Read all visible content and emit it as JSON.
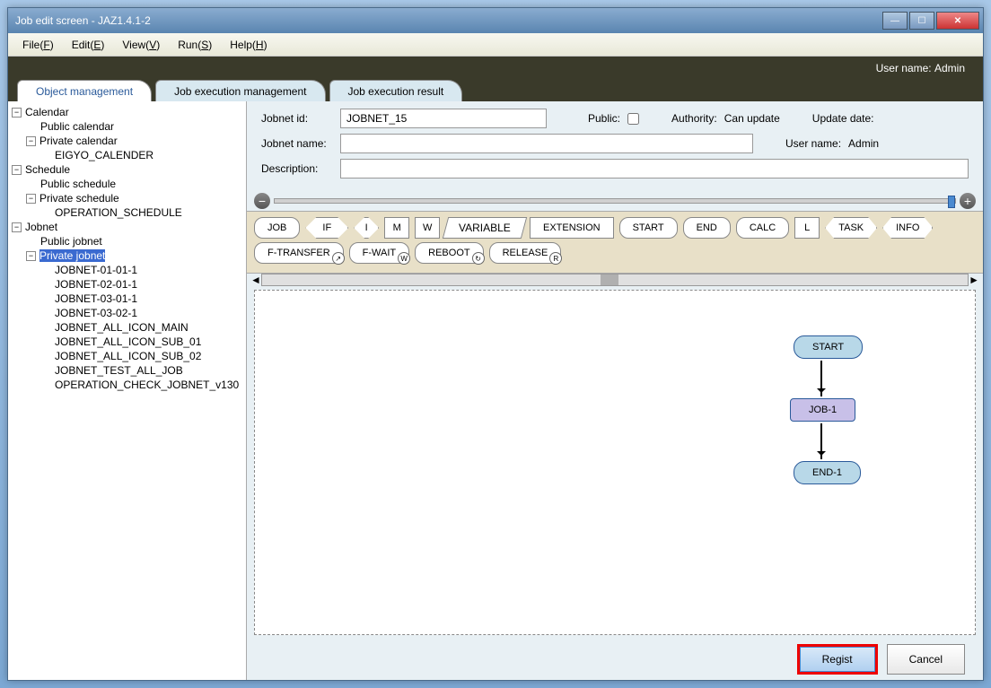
{
  "window": {
    "title": "Job edit screen - JAZ1.4.1-2"
  },
  "menu": {
    "file": "File(F)",
    "edit": "Edit(E)",
    "view": "View(V)",
    "run": "Run(S)",
    "help": "Help(H)"
  },
  "header": {
    "user_label": "User name:",
    "user_value": "Admin"
  },
  "tabs": {
    "t1": "Object management",
    "t2": "Job execution management",
    "t3": "Job execution result"
  },
  "tree": {
    "calendar": "Calendar",
    "public_calendar": "Public calendar",
    "private_calendar": "Private calendar",
    "eigyo": "EIGYO_CALENDER",
    "schedule": "Schedule",
    "public_schedule": "Public schedule",
    "private_schedule": "Private schedule",
    "op_schedule": "OPERATION_SCHEDULE",
    "jobnet": "Jobnet",
    "public_jobnet": "Public jobnet",
    "private_jobnet": "Private jobnet",
    "j1": "JOBNET-01-01-1",
    "j2": "JOBNET-02-01-1",
    "j3": "JOBNET-03-01-1",
    "j4": "JOBNET-03-02-1",
    "j5": "JOBNET_ALL_ICON_MAIN",
    "j6": "JOBNET_ALL_ICON_SUB_01",
    "j7": "JOBNET_ALL_ICON_SUB_02",
    "j8": "JOBNET_TEST_ALL_JOB",
    "j9": "OPERATION_CHECK_JOBNET_v130"
  },
  "form": {
    "jobnet_id_label": "Jobnet id:",
    "jobnet_id_value": "JOBNET_15",
    "public_label": "Public:",
    "authority_label": "Authority:",
    "authority_value": "Can update",
    "update_label": "Update date:",
    "jobnet_name_label": "Jobnet name:",
    "user_label": "User name:",
    "user_value": "Admin",
    "description_label": "Description:"
  },
  "tools": {
    "job": "JOB",
    "if": "IF",
    "variable": "VARIABLE",
    "extension": "EXTENSION",
    "start": "START",
    "end": "END",
    "calc": "CALC",
    "task": "TASK",
    "info": "INFO",
    "ftransfer": "F-TRANSFER",
    "fwait": "F-WAIT",
    "reboot": "REBOOT",
    "release": "RELEASE",
    "l": "L",
    "i": "I",
    "m": "M",
    "w": "W"
  },
  "canvas": {
    "start": "START",
    "job1": "JOB-1",
    "end1": "END-1"
  },
  "buttons": {
    "regist": "Regist",
    "cancel": "Cancel"
  }
}
